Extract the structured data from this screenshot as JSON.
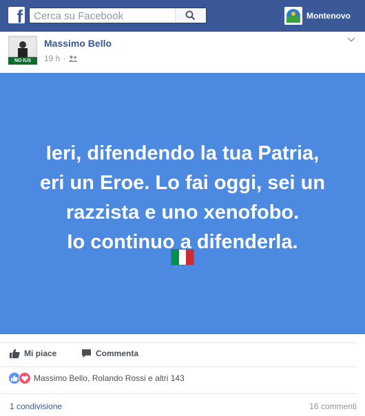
{
  "topbar": {
    "search_placeholder": "Cerca su Facebook",
    "user_name": "Montenovo"
  },
  "post": {
    "author": "Massimo Bello",
    "avatar_badge": "NO IUS SOLI",
    "time": "19 h",
    "lines": [
      "Ieri, difendendo la tua Patria,",
      "eri un Eroe. Lo fai oggi, sei un",
      "razzista e uno xenofobo.",
      "Io continuo a difenderla."
    ],
    "background_color": "#4b8ae0",
    "flag_colors": [
      "#009246",
      "#ffffff",
      "#ce2b37"
    ]
  },
  "actions": {
    "like": "Mi piace",
    "comment": "Commenta"
  },
  "reactions": {
    "text": "Massimo Bello, Rolando Rossi e altri 143"
  },
  "footer": {
    "shares": "1 condivisione",
    "comments": "16 commenti"
  },
  "colors": {
    "brand": "#3b5998",
    "link": "#365899",
    "like_blue": "#5890ff",
    "love_red": "#f25268"
  }
}
